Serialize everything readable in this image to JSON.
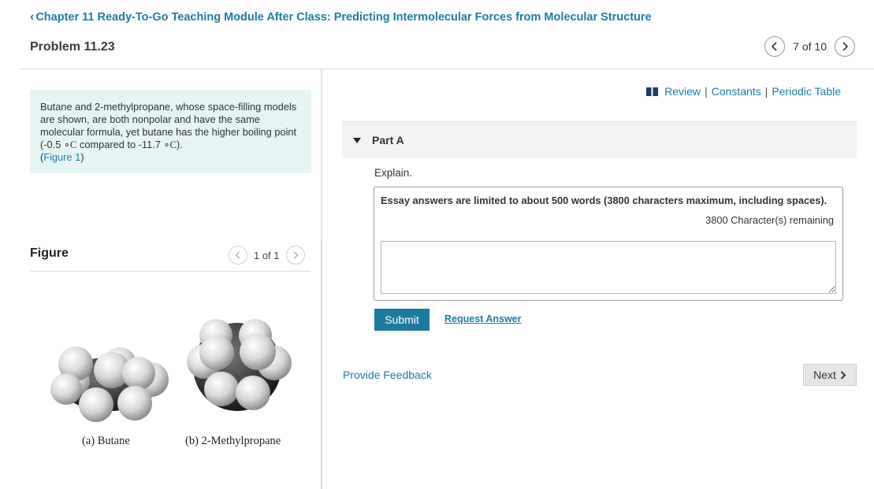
{
  "header": {
    "back_label": "Chapter 11 Ready-To-Go Teaching Module After Class: Predicting Intermolecular Forces from Molecular Structure",
    "problem_title": "Problem 11.23",
    "pager_text": "7 of 10"
  },
  "problem": {
    "text_main": "Butane and 2-methylpropane, whose space-filling models are shown, are both nonpolar and have the same molecular formula, yet butane has the higher boiling point (-0.5",
    "unit": "∘C",
    "text_mid": " compared to -11.7",
    "text_end": ").",
    "figure_open": "(",
    "figure_link": "Figure 1",
    "figure_close": ")"
  },
  "figure": {
    "title": "Figure",
    "pager_text": "1 of 1",
    "labels": [
      "(a) Butane",
      "(b) 2-Methylpropane"
    ]
  },
  "toolbar": {
    "review": "Review",
    "sep": "|",
    "constants": "Constants",
    "periodic_table": "Periodic Table"
  },
  "part": {
    "label": "Part A",
    "prompt": "Explain.",
    "essay_limit": "Essay answers are limited to about 500 words (3800 characters maximum, including spaces).",
    "remaining": "3800 Character(s) remaining",
    "submit": "Submit",
    "request_answer": "Request Answer"
  },
  "footer": {
    "feedback": "Provide Feedback",
    "next": "Next"
  },
  "colors": {
    "link": "#1e7da3",
    "submit_bg": "#1c7aa0",
    "problem_bg": "#e6f4f4"
  }
}
